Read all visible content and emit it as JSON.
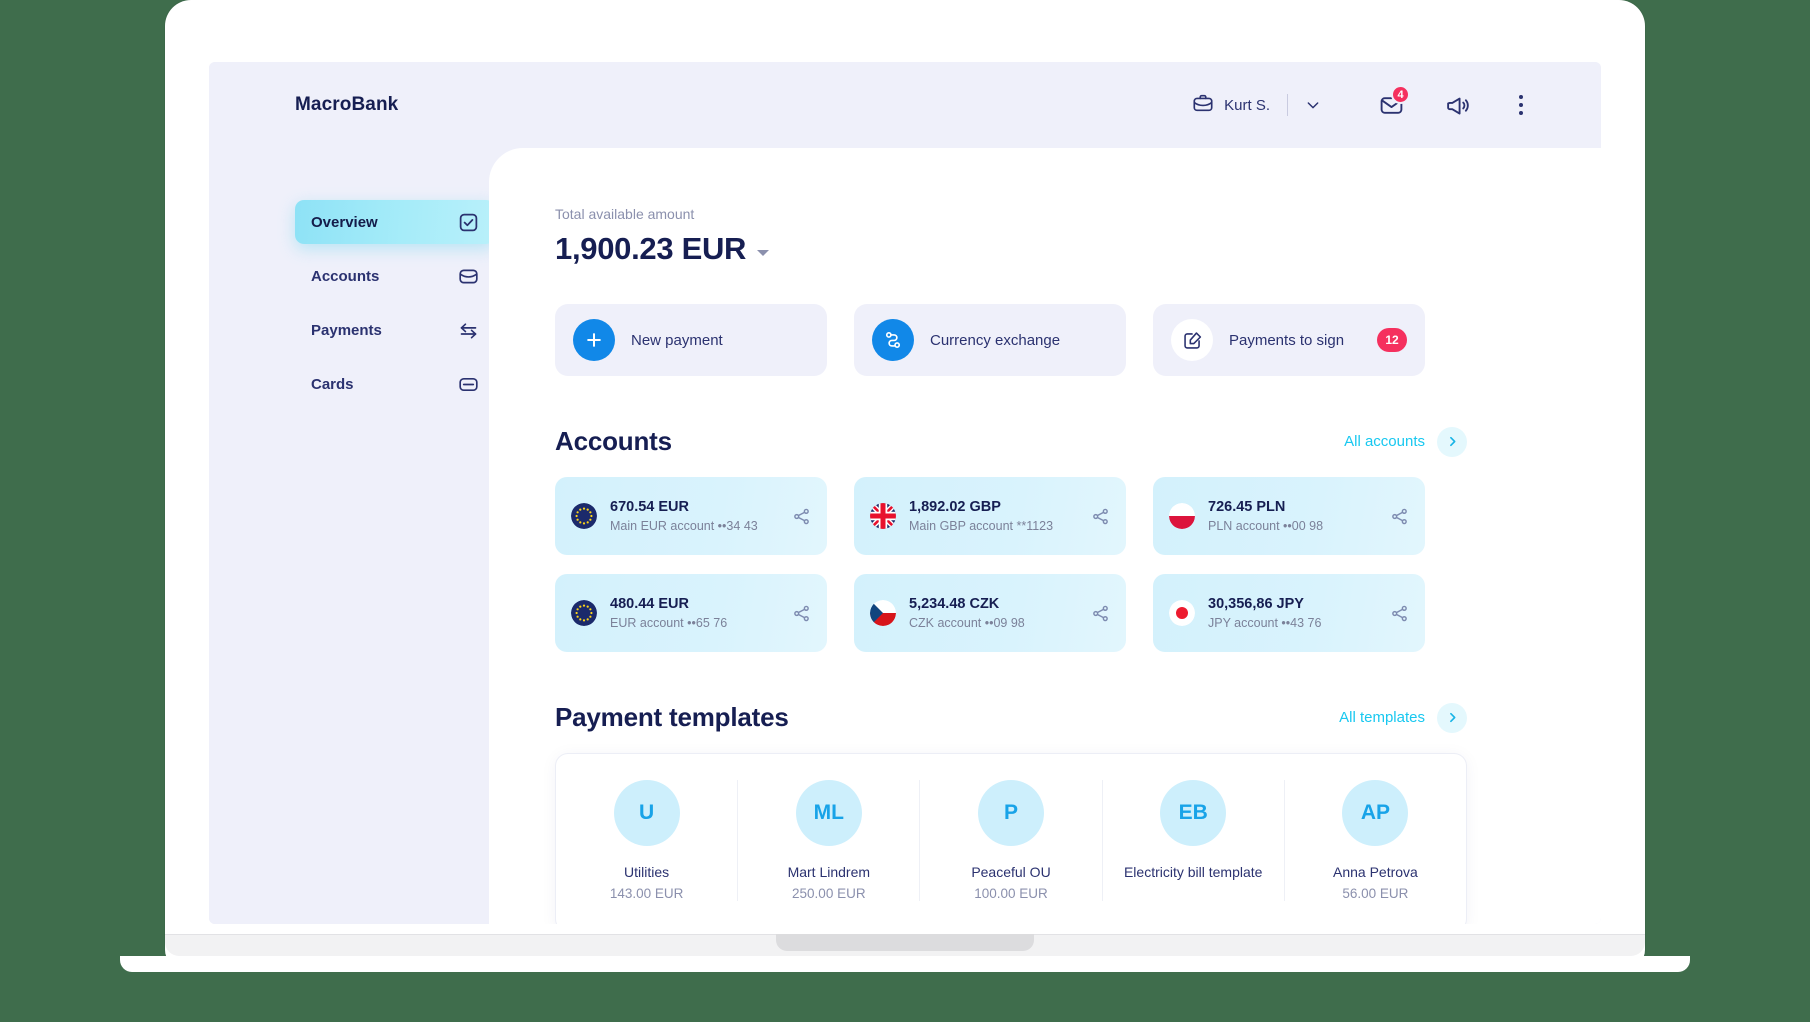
{
  "app": {
    "brand": "MacroBank"
  },
  "topbar": {
    "user_name": "Kurt S.",
    "briefcase_icon": "briefcase-icon",
    "chevron_icon": "chevron-down-icon",
    "mail_icon": "mail-icon",
    "mail_badge": "4",
    "megaphone_icon": "megaphone-icon",
    "more_icon": "more-vertical-icon"
  },
  "sidebar": {
    "items": [
      {
        "label": "Overview",
        "icon": "check-square-icon",
        "active": true
      },
      {
        "label": "Accounts",
        "icon": "inbox-icon",
        "active": false
      },
      {
        "label": "Payments",
        "icon": "transfer-arrows-icon",
        "active": false
      },
      {
        "label": "Cards",
        "icon": "credit-card-icon",
        "active": false
      }
    ]
  },
  "summary": {
    "label": "Total available amount",
    "amount": "1,900.23 EUR"
  },
  "actions": [
    {
      "label": "New payment",
      "icon": "plus-icon",
      "style": "blue",
      "badge": ""
    },
    {
      "label": "Currency exchange",
      "icon": "currency-exchange-icon",
      "style": "blue",
      "badge": ""
    },
    {
      "label": "Payments to sign",
      "icon": "edit-square-icon",
      "style": "white",
      "badge": "12"
    }
  ],
  "accounts_section": {
    "title": "Accounts",
    "link": "All accounts",
    "link_icon": "chevron-right-icon",
    "cards": [
      {
        "flag": "eu-flag",
        "amount": "670.54 EUR",
        "desc": "Main EUR account ••34 43",
        "share_icon": "share-icon"
      },
      {
        "flag": "gb-flag",
        "amount": "1,892.02 GBP",
        "desc": "Main GBP account **1123",
        "share_icon": "share-icon"
      },
      {
        "flag": "pl-flag",
        "amount": "726.45 PLN",
        "desc": "PLN account ••00 98",
        "share_icon": "share-icon"
      },
      {
        "flag": "eu-flag",
        "amount": "480.44 EUR",
        "desc": "EUR account ••65 76",
        "share_icon": "share-icon"
      },
      {
        "flag": "cz-flag",
        "amount": "5,234.48 CZK",
        "desc": "CZK account ••09 98",
        "share_icon": "share-icon"
      },
      {
        "flag": "jp-flag",
        "amount": "30,356,86 JPY",
        "desc": "JPY account ••43 76",
        "share_icon": "share-icon"
      }
    ]
  },
  "templates_section": {
    "title": "Payment templates",
    "link": "All templates",
    "link_icon": "chevron-right-icon",
    "items": [
      {
        "initials": "U",
        "name": "Utilities",
        "amount": "143.00 EUR"
      },
      {
        "initials": "ML",
        "name": "Mart Lindrem",
        "amount": "250.00 EUR"
      },
      {
        "initials": "P",
        "name": "Peaceful OU",
        "amount": "100.00 EUR"
      },
      {
        "initials": "EB",
        "name": "Electricity bill template",
        "amount": ""
      },
      {
        "initials": "AP",
        "name": "Anna  Petrova",
        "amount": "56.00 EUR"
      }
    ]
  },
  "colors": {
    "background": "#3f6d4c",
    "chrome": "#eff0fa",
    "navy": "#161e52",
    "accent_blue": "#1188e8",
    "accent_cyan": "#18c8f0",
    "badge_red": "#f5305e",
    "account_card": "#d6f2fd"
  }
}
